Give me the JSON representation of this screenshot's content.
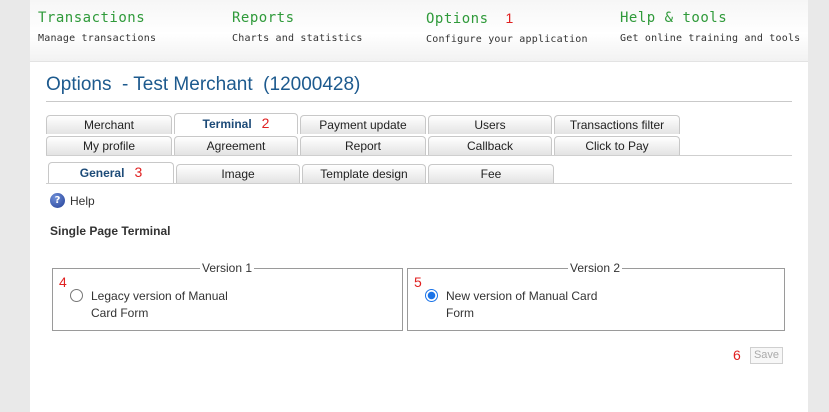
{
  "nav": {
    "items": [
      {
        "title": "Transactions",
        "subtitle": "Manage transactions",
        "marker": ""
      },
      {
        "title": "Reports",
        "subtitle": "Charts and statistics",
        "marker": ""
      },
      {
        "title": "Options",
        "subtitle": "Configure your application",
        "marker": "1"
      },
      {
        "title": "Help & tools",
        "subtitle": "Get online training and tools",
        "marker": ""
      }
    ]
  },
  "page": {
    "title": "Options  - Test Merchant  (12000428)"
  },
  "tabs": {
    "row1": [
      "Merchant",
      "Terminal",
      "Payment update",
      "Users",
      "Transactions filter"
    ],
    "row2": [
      "My profile",
      "Agreement",
      "Report",
      "Callback",
      "Click to Pay"
    ],
    "active_marker": "2"
  },
  "subtabs": {
    "items": [
      "General",
      "Image",
      "Template design",
      "Fee"
    ],
    "active_marker": "3"
  },
  "help": {
    "label": "Help",
    "icon": "help-icon"
  },
  "section": {
    "title": "Single Page Terminal"
  },
  "versions": [
    {
      "legend": "Version 1",
      "marker": "4",
      "label": "Legacy version of Manual Card Form",
      "checked": false
    },
    {
      "legend": "Version 2",
      "marker": "5",
      "label": "New version of Manual Card Form",
      "checked": true
    }
  ],
  "save": {
    "label": "Save",
    "marker": "6"
  },
  "colors": {
    "nav_green": "#2f9a3a",
    "title_blue": "#1d5a8e",
    "marker_red": "#e02020",
    "radio_blue": "#1a73e8"
  }
}
